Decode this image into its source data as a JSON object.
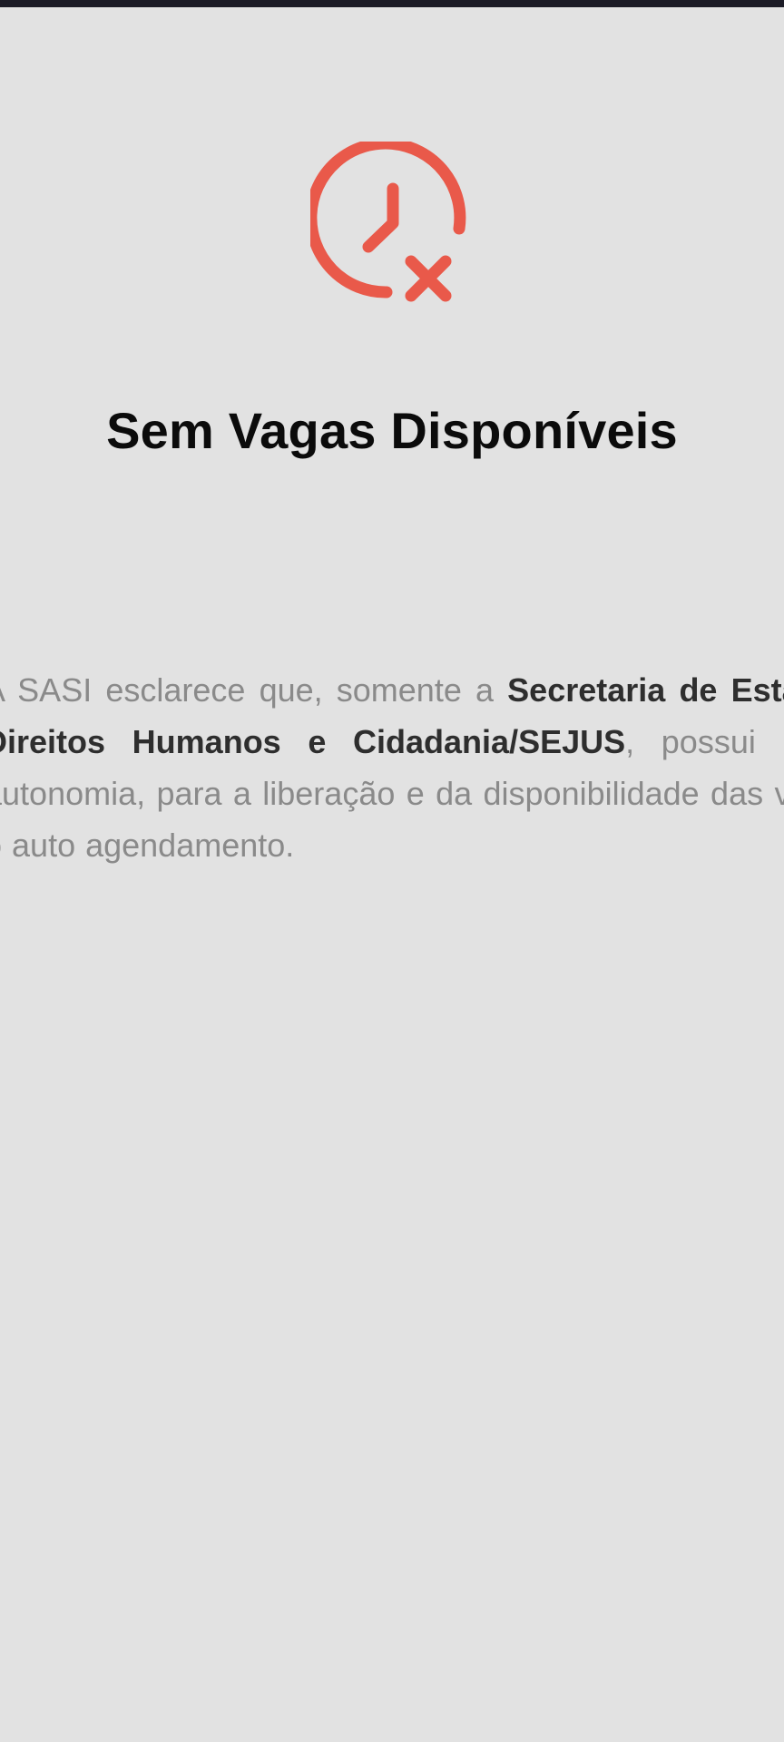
{
  "status": {
    "icon": "clock-x-icon",
    "accent_color": "#e9594a",
    "title": "Sem Vagas Disponíveis"
  },
  "notice": {
    "lead": "A SASI esclarece que, somente a ",
    "bold": "Secretaria de Estado de Justiça, Direitos Humanos e Cidadania/SEJUS",
    "tail": ", possui a autoridade e autonomia, para a liberação e da disponibilidade das vagas/datas para o auto agendamento."
  }
}
